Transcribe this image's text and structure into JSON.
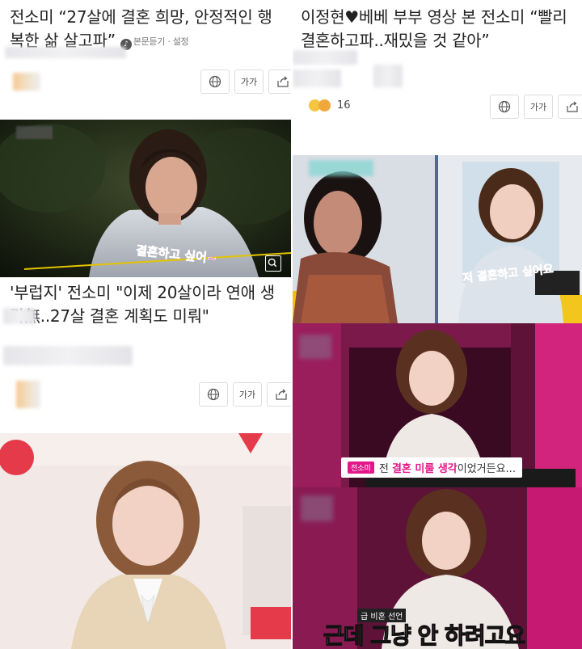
{
  "article1": {
    "headline": "전소미 “27살에 결혼 희망, 안정적인 행복한 삶 살고파”",
    "meta_listen": "본문듣기",
    "meta_sep": "·",
    "meta_settings": "설정",
    "font_button": "가가"
  },
  "article2": {
    "headline": "이정현♥베베 부부 영상 본 전소미 “빨리 결혼하고파..재밌을 것 같아”",
    "reaction_count": "16",
    "font_button": "가가"
  },
  "article3": {
    "headline": "'부럽지' 전소미 \"이제 20살이라 연애 생각無..27살 결혼 계획도 미뤄\"",
    "image_caption": "결혼하고 싶어~",
    "font_button": "가가"
  },
  "photo_talk": {
    "caption": "저 결혼하고 싶어요"
  },
  "photo_show1": {
    "tag": "전소미",
    "subtitle_pre": "전 ",
    "subtitle_hl": "결혼 미룰 생각",
    "subtitle_post": "이었거든요..."
  },
  "photo_show2": {
    "tag": "급 비혼 선언",
    "subtitle_pre": "근데 그냥 ",
    "subtitle_hl": "안 하려고요"
  },
  "colors": {
    "pink_accent": "#e4178a",
    "stage_pink": "#c61a72"
  }
}
